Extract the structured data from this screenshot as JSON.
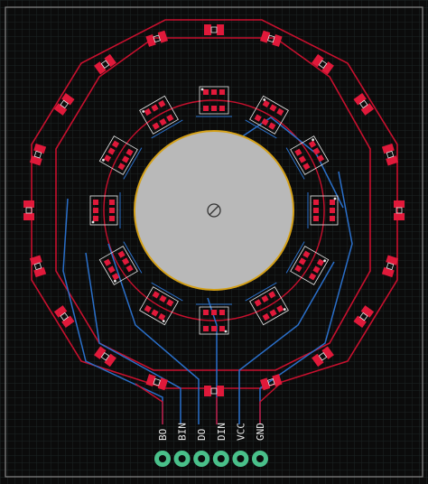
{
  "colors": {
    "background": "#0b0b0b",
    "grid": "#222a2a",
    "outline": "#8a8a8a",
    "top_copper": "#c8102e",
    "bottom_copper": "#2a6fc9",
    "pad": "#e0193a",
    "silk": "#e8e8e8",
    "connector": "#49c08a",
    "circle": "#d4a017"
  },
  "connector": {
    "pins": [
      "BO",
      "BIN",
      "DO",
      "DIN",
      "VCC",
      "GND"
    ]
  },
  "inner_leds": 12,
  "outer_pads": 20
}
